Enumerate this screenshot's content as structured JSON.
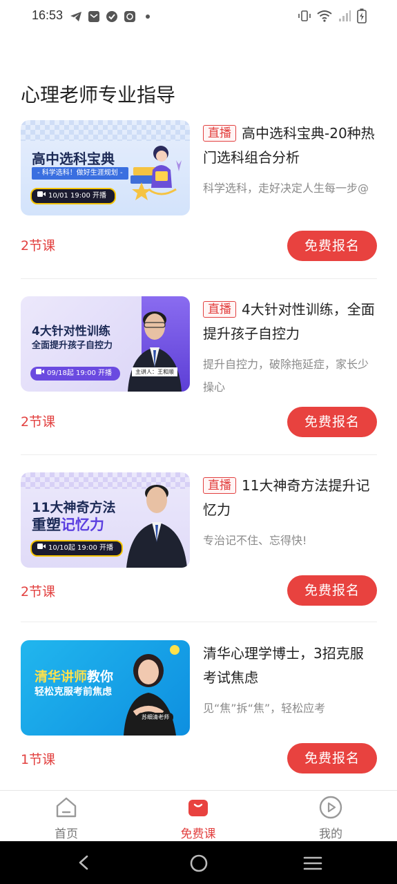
{
  "status_bar": {
    "time": "16:53"
  },
  "page": {
    "title": "心理老师专业指导"
  },
  "courses": [
    {
      "tag": "直播",
      "title": "高中选科宝典-20种热门选科组合分析",
      "desc": "科学选科，走好决定人生每一步@",
      "lessons": "2节课",
      "cta": "免费报名",
      "thumb": {
        "line1": "高中选科宝典",
        "line2": "- 科学选科！做好生涯规划 -",
        "date": "10/01 19:00 开播"
      }
    },
    {
      "tag": "直播",
      "title": "4大针对性训练，全面提升孩子自控力",
      "desc": "提升自控力，破除拖延症，家长少操心",
      "lessons": "2节课",
      "cta": "免费报名",
      "thumb": {
        "line1": "4大针对性训练",
        "line2": "全面提升孩子自控力",
        "date": "09/18起 19:00 开播",
        "speaker": "主讲人：王和顺"
      }
    },
    {
      "tag": "直播",
      "title": "11大神奇方法提升记忆力",
      "desc": "专治记不住、忘得快!",
      "lessons": "2节课",
      "cta": "免费报名",
      "thumb": {
        "line1": "11大神奇方法",
        "line2a": "重塑",
        "line2b": "记忆力",
        "date": "10/10起 19:00 开播"
      }
    },
    {
      "title": "清华心理学博士，3招克服考试焦虑",
      "desc": "见“焦”拆“焦”，轻松应考",
      "lessons": "1节课",
      "cta": "免费报名",
      "thumb": {
        "line1a": "清华讲师",
        "line1b": "教你",
        "line2": "轻松克服考前焦虑",
        "speaker": "苏细清老师"
      }
    }
  ],
  "tabs": [
    {
      "label": "首页",
      "icon": "home-icon"
    },
    {
      "label": "免费课",
      "icon": "free-course-icon",
      "active": true
    },
    {
      "label": "我的",
      "icon": "profile-play-icon"
    }
  ],
  "colors": {
    "accent": "#e8423f",
    "text": "#222222",
    "muted": "#8a8a8a"
  }
}
